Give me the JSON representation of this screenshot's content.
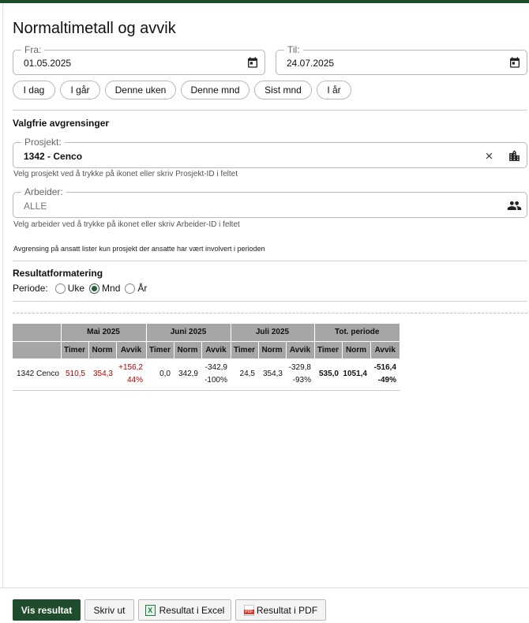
{
  "title": "Normaltimetall og avvik",
  "date_from": {
    "legend": "Fra:",
    "value": "01.05.2025",
    "icon": "calendar-icon"
  },
  "date_to": {
    "legend": "Til:",
    "value": "24.07.2025",
    "icon": "calendar-icon"
  },
  "quick_ranges": [
    "I dag",
    "I går",
    "Denne uken",
    "Denne mnd",
    "Sist mnd",
    "I år"
  ],
  "optional_filters": {
    "heading": "Valgfrie avgrensinger",
    "project": {
      "legend": "Prosjekt:",
      "value": "1342 - Cenco",
      "helper": "Velg prosjekt ved å trykke på ikonet eller skriv Prosjekt-ID i feltet"
    },
    "worker": {
      "legend": "Arbeider:",
      "placeholder": "ALLE",
      "helper": "Velg arbeider ved å trykke på ikonet eller skriv Arbeider-ID i feltet"
    },
    "note": "Avgrensing på ansatt lister kun prosjekt der ansatte har vært involvert i perioden"
  },
  "formatting": {
    "heading": "Resultatformatering",
    "period_label": "Periode:",
    "options": [
      "Uke",
      "Mnd",
      "År"
    ],
    "selected": "Mnd"
  },
  "table": {
    "groups": [
      "Mai 2025",
      "Juni 2025",
      "Juli 2025",
      "Tot. periode"
    ],
    "subheaders": [
      "Timer",
      "Norm",
      "Avvik"
    ],
    "rows": [
      {
        "name": "1342 Cenco",
        "mai": {
          "timer": "510,5",
          "norm": "354,3",
          "avvik": "+156,2",
          "pct": "44%"
        },
        "juni": {
          "timer": "0,0",
          "norm": "342,9",
          "avvik": "-342,9",
          "pct": "-100%"
        },
        "juli": {
          "timer": "24,5",
          "norm": "354,3",
          "avvik": "-329,8",
          "pct": "-93%"
        },
        "tot": {
          "timer": "535,0",
          "norm": "1051,4",
          "avvik": "-516,4",
          "pct": "-49%"
        }
      }
    ]
  },
  "buttons": {
    "show": "Vis resultat",
    "print": "Skriv ut",
    "excel": "Resultat i Excel",
    "pdf": "Resultat i PDF"
  },
  "colors": {
    "brand": "#1f4d2c",
    "negative": "#b40000"
  }
}
